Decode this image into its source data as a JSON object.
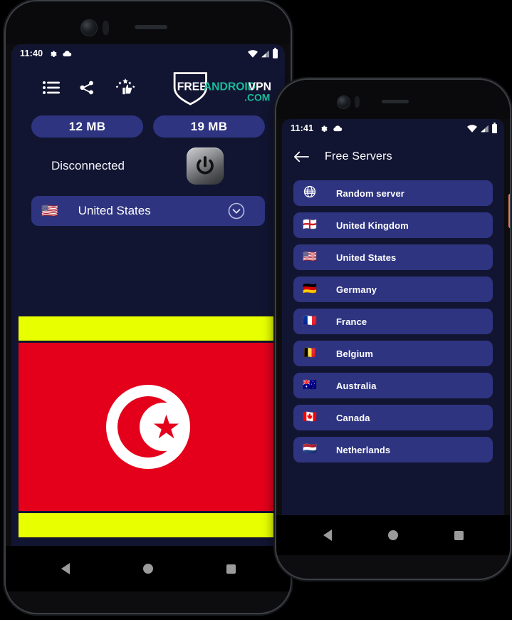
{
  "phone1": {
    "status_bar": {
      "time": "11:40",
      "icons_left": [
        "gear-icon",
        "cloud-icon"
      ],
      "icons_right": [
        "wifi-icon",
        "signal-icon",
        "battery-icon"
      ]
    },
    "toolbar": {
      "menu_label": "list-icon",
      "share_label": "share-icon",
      "rate_label": "rate-icon"
    },
    "logo": {
      "part1": "FREE",
      "part2": "ANDROID",
      "part3": "VPN",
      "part4": ".COM",
      "color_accent": "#1abc9c",
      "color_plain": "#ffffff"
    },
    "stats": {
      "download": "12 MB",
      "upload": "19 MB"
    },
    "connection": {
      "status": "Disconnected",
      "power_button": "power-icon"
    },
    "selected_server": {
      "flag": "🇺🇸",
      "name": "United States",
      "chevron": "chevron-down-icon"
    },
    "ad_banner": {
      "bar_color": "#e8ff00",
      "field_color": "#e4001b",
      "emblem": "crescent-star"
    },
    "navbar": {
      "back": "back-triangle-icon",
      "home": "home-circle-icon",
      "recents": "recents-square-icon"
    }
  },
  "phone2": {
    "status_bar": {
      "time": "11:41",
      "icons_left": [
        "gear-icon",
        "cloud-icon"
      ],
      "icons_right": [
        "wifi-icon",
        "signal-icon",
        "battery-icon"
      ]
    },
    "appbar": {
      "back": "back-arrow-icon",
      "title": "Free Servers"
    },
    "servers": [
      {
        "flag": "globe",
        "name": "Random server"
      },
      {
        "flag": "🏴󠁧󠁢󠁥󠁮󠁧󠁿",
        "name": "United Kingdom"
      },
      {
        "flag": "🇺🇸",
        "name": "United States"
      },
      {
        "flag": "🇩🇪",
        "name": "Germany"
      },
      {
        "flag": "🇫🇷",
        "name": "France"
      },
      {
        "flag": "🇧🇪",
        "name": "Belgium"
      },
      {
        "flag": "🇦🇺",
        "name": "Australia"
      },
      {
        "flag": "🇨🇦",
        "name": "Canada"
      },
      {
        "flag": "🇳🇱",
        "name": "Netherlands"
      }
    ],
    "navbar": {
      "back": "back-triangle-icon",
      "home": "home-circle-icon",
      "recents": "recents-square-icon"
    }
  },
  "theme": {
    "screen_bg": "#121531",
    "accent_blue": "#2e3480",
    "text_white": "#ffffff"
  }
}
